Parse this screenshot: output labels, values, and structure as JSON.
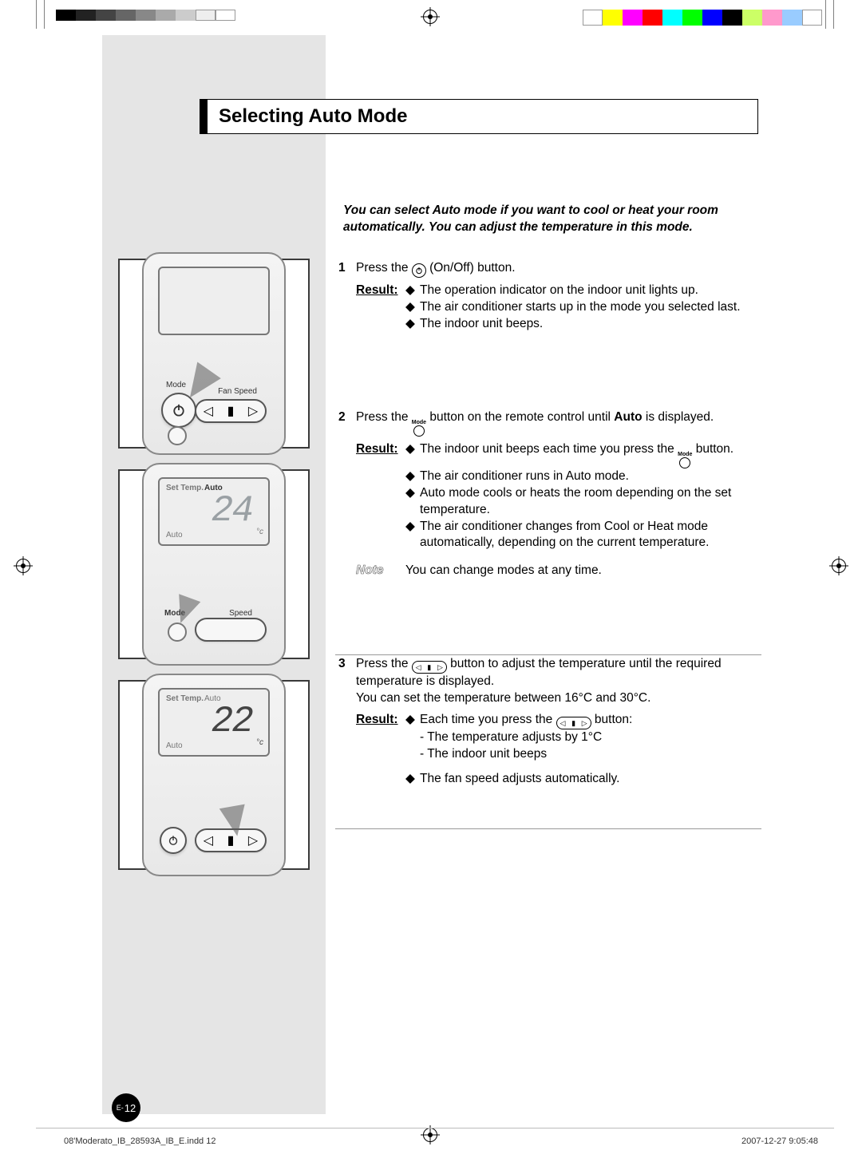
{
  "title": "Selecting Auto Mode",
  "intro": "You can select Auto mode if you want to cool or heat your room automatically. You can adjust the temperature in this mode.",
  "steps": {
    "s1": {
      "num": "1",
      "text_a": "Press the ",
      "text_b": " (On/Off) button.",
      "result_label": "Result",
      "bullets": [
        "The operation indicator on the indoor unit lights up.",
        "The air conditioner starts up in the mode you selected last.",
        "The indoor unit beeps."
      ]
    },
    "s2": {
      "num": "2",
      "text_a": "Press the ",
      "text_b": " button on the remote control until ",
      "text_bold": "Auto",
      "text_c": " is displayed.",
      "result_label": "Result",
      "bullets": [
        "The indoor unit beeps each time you press the ",
        "The air conditioner runs in Auto mode.",
        "Auto mode cools or heats the room depending on the set temperature.",
        "The air conditioner changes from Cool or Heat mode automatically, depending on the current temperature."
      ],
      "bullet0_tail": " button.",
      "note_label": "Note",
      "note_text": "You can change modes at any time."
    },
    "s3": {
      "num": "3",
      "text_a": "Press the ",
      "text_b": " button to adjust the temperature until the required temperature is displayed.",
      "text_line2": "You can set the temperature between 16°C and 30°C.",
      "result_label": "Result",
      "bullet0_a": "Each time you press the ",
      "bullet0_b": " button:",
      "sub1": "- The temperature adjusts by 1°C",
      "sub2": "- The indoor unit beeps",
      "bullet1": "The fan speed adjusts automatically."
    }
  },
  "illus": {
    "mode_label": "Mode",
    "fanspeed_label": "Fan Speed",
    "speed_label": "Speed",
    "settemp_label": "Set Temp.",
    "auto_label": "Auto",
    "display1": "24",
    "display2": "22",
    "unit": "°c"
  },
  "glyphs": {
    "mode_tiny": "Mode"
  },
  "page": {
    "prefix": "E-",
    "number": "12"
  },
  "footer": {
    "left": "08'Moderato_IB_28593A_IB_E.indd   12",
    "right": "2007-12-27   9:05:48"
  }
}
